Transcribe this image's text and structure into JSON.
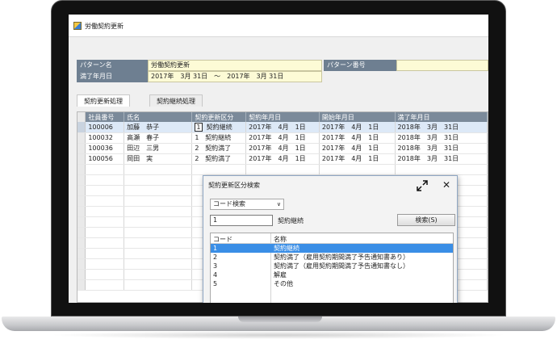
{
  "window": {
    "title": "労働契約更新"
  },
  "form": {
    "pattern_name_label": "パターン名",
    "pattern_name_value": "労働契約更新",
    "pattern_number_label": "パターン番号",
    "pattern_number_value": "",
    "expiry_label": "満了年月日",
    "expiry_value": "2017年　3月 31日　～　2017年　3月 31日"
  },
  "tabs": [
    {
      "label": "契約更新処理"
    },
    {
      "label": "契約継続処理"
    }
  ],
  "grid": {
    "columns": [
      "社員番号",
      "氏名",
      "契約更新区分",
      "契約年月日",
      "開始年月日",
      "満了年月日"
    ],
    "rows": [
      {
        "emp_no": "100006",
        "name": "加藤　恭子",
        "code": "1",
        "status": "契約継続",
        "contract_date": "2017年　4月　1日",
        "start_date": "2017年　4月　1日",
        "end_date": "2018年　3月　31日"
      },
      {
        "emp_no": "100032",
        "name": "高瀬　春子",
        "code": "1",
        "status": "契約継続",
        "contract_date": "2017年　4月　1日",
        "start_date": "2017年　4月　1日",
        "end_date": "2018年　3月　31日"
      },
      {
        "emp_no": "100036",
        "name": "田辺　三男",
        "code": "2",
        "status": "契約満了",
        "contract_date": "2017年　4月　1日",
        "start_date": "2017年　4月　1日",
        "end_date": "2018年　3月　31日"
      },
      {
        "emp_no": "100056",
        "name": "岡田　実",
        "code": "2",
        "status": "契約満了",
        "contract_date": "2017年　4月　1日",
        "start_date": "2017年　4月　1日",
        "end_date": "2018年　3月　31日"
      }
    ]
  },
  "dialog": {
    "title": "契約更新区分検索",
    "search_mode": "コード検索",
    "code_value": "1",
    "code_name": "契約継続",
    "search_button": "検索(S)",
    "list_headers": {
      "code": "コード",
      "name": "名称"
    },
    "items": [
      {
        "code": "1",
        "name": "契約継続"
      },
      {
        "code": "2",
        "name": "契約満了（雇用契約期間満了予告通知書あり）"
      },
      {
        "code": "3",
        "name": "契約満了（雇用契約期間満了予告通知書なし）"
      },
      {
        "code": "4",
        "name": "解雇"
      },
      {
        "code": "5",
        "name": "その他"
      }
    ]
  },
  "icons": {
    "app": "contract-app-icon",
    "expand": "expand-arrows-icon",
    "close": "close-icon",
    "dropdown": "chevron-down-icon"
  },
  "colors": {
    "label_bg": "#6e7f91",
    "value_bg": "#fdfbd6",
    "header_bg": "#7b8a9a",
    "selection": "#3a8ee6"
  }
}
